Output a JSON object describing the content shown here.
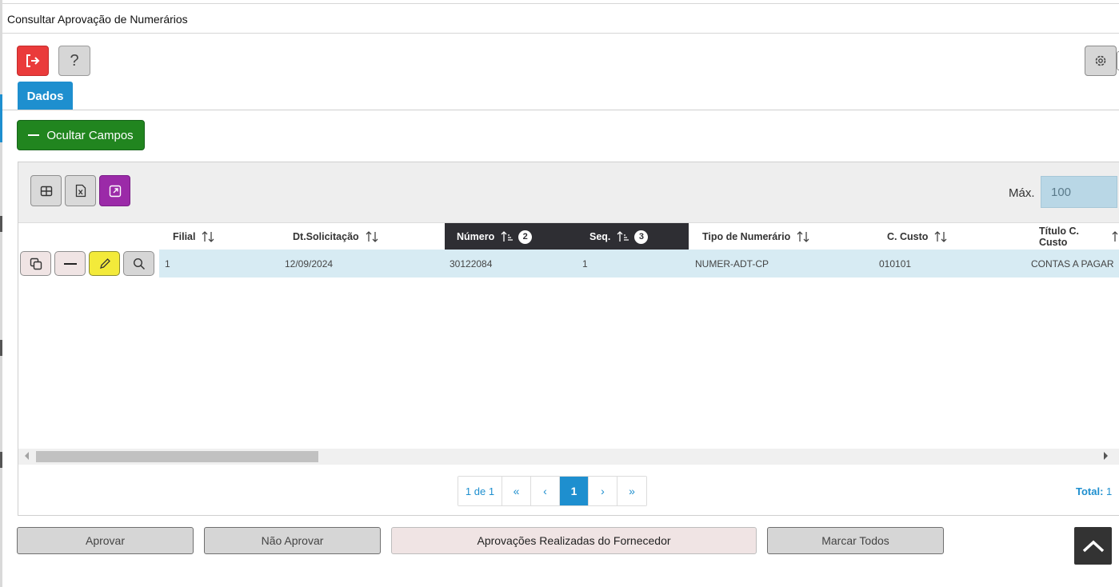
{
  "window": {
    "title": "Consultar Aprovação de Numerários"
  },
  "toolbar": {
    "exit_icon": "sign-out-icon",
    "help_label": "?",
    "settings_icon": "gear-icon",
    "colors": {
      "exit": "#ea3b3b",
      "help": "#d6d6d6"
    }
  },
  "tabs": [
    {
      "label": "Dados",
      "active": true
    }
  ],
  "toggle_fields": {
    "label": "Ocultar Campos",
    "icon": "minus-icon",
    "color": "#21851f"
  },
  "grid_toolbar": {
    "buttons": [
      {
        "icon": "grid-layout-icon"
      },
      {
        "icon": "excel-export-icon"
      },
      {
        "icon": "expand-icon",
        "color": "#9b2aa8"
      }
    ],
    "max_label": "Máx.",
    "max_value": "100"
  },
  "table": {
    "columns": [
      {
        "label": "Filial",
        "sorted": false
      },
      {
        "label": "Dt.Solicitação",
        "sorted": false
      },
      {
        "label": "Número",
        "sorted": true,
        "order": "2"
      },
      {
        "label": "Seq.",
        "sorted": true,
        "order": "3"
      },
      {
        "label": "Tipo de Numerário",
        "sorted": false
      },
      {
        "label": "C. Custo",
        "sorted": false
      },
      {
        "label": "Título C. Custo",
        "sorted": false
      }
    ],
    "rows": [
      {
        "actions": [
          "copy-icon",
          "minus-icon",
          "pencil-icon",
          "search-icon"
        ],
        "cells": [
          "1",
          "12/09/2024",
          "30122084",
          "1",
          "NUMER-ADT-CP",
          "010101",
          "CONTAS A PAGAR"
        ]
      }
    ]
  },
  "pagination": {
    "info": "1 de 1",
    "first": "«",
    "prev": "‹",
    "current": "1",
    "next": "›",
    "last": "»",
    "total_label": "Total:",
    "total_value": "1"
  },
  "actions": {
    "approve": "Aprovar",
    "reject": "Não Aprovar",
    "supplier_approvals": "Aprovações Realizadas do Fornecedor",
    "mark_all": "Marcar Todos"
  },
  "scroll_top_icon": "chevron-up-icon"
}
